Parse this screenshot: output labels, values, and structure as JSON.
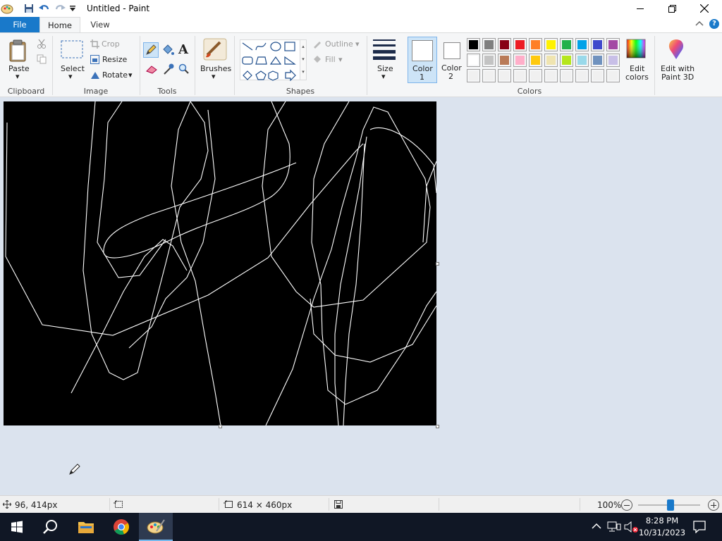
{
  "window": {
    "title": "Untitled - Paint",
    "quick_access": [
      "paint-app-icon",
      "save-icon",
      "undo-icon",
      "redo-icon",
      "customize-icon"
    ]
  },
  "tabs": {
    "file": "File",
    "home": "Home",
    "view": "View"
  },
  "ribbon": {
    "clipboard": {
      "label": "Clipboard",
      "paste": "Paste"
    },
    "image": {
      "label": "Image",
      "select": "Select",
      "crop": "Crop",
      "resize": "Resize",
      "rotate": "Rotate"
    },
    "tools": {
      "label": "Tools"
    },
    "brushes": {
      "label": "Brushes"
    },
    "shapes": {
      "label": "Shapes",
      "outline": "Outline",
      "fill": "Fill"
    },
    "size": {
      "label": "Size"
    },
    "color1": {
      "label": "Color",
      "num": "1"
    },
    "color2": {
      "label": "Color",
      "num": "2"
    },
    "colors": {
      "label": "Colors",
      "edit_line1": "Edit",
      "edit_line2": "colors",
      "row1": [
        "#000000",
        "#7f7f7f",
        "#880015",
        "#ed1c24",
        "#ff7f27",
        "#fff200",
        "#22b14c",
        "#00a2e8",
        "#3f48cc",
        "#a349a4"
      ],
      "row2": [
        "#ffffff",
        "#c3c3c3",
        "#b97a57",
        "#ffaec9",
        "#ffc90e",
        "#efe4b0",
        "#b5e61d",
        "#99d9ea",
        "#7092be",
        "#c8bfe7"
      ],
      "row3": [
        "#f0f0f0",
        "#f0f0f0",
        "#f0f0f0",
        "#f0f0f0",
        "#f0f0f0",
        "#f0f0f0",
        "#f0f0f0",
        "#f0f0f0",
        "#f0f0f0",
        "#f0f0f0"
      ]
    },
    "paint3d": {
      "line1": "Edit with",
      "line2": "Paint 3D"
    }
  },
  "canvas": {
    "background": "#000000",
    "stroke": "#ffffff"
  },
  "statusbar": {
    "cursor_position": "96, 414px",
    "image_size": "614 × 460px",
    "zoom": "100%",
    "zoom_level": 1.0
  },
  "taskbar": {
    "time": "8:28 PM",
    "date": "10/31/2023",
    "apps": [
      "start-icon",
      "search-icon",
      "file-explorer-icon",
      "chrome-icon",
      "paint-icon"
    ]
  }
}
